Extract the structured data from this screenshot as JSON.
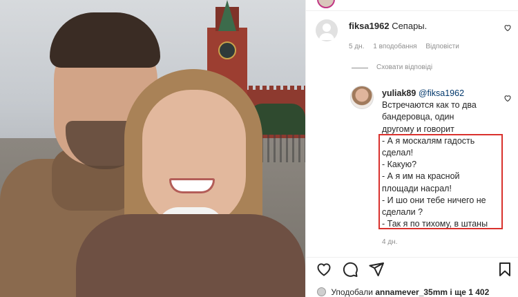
{
  "comments": [
    {
      "username": "fiksa1962",
      "text": "Сепары.",
      "time": "5 дн.",
      "likes": "1 вподобання",
      "reply": "Відповісти"
    },
    {
      "username": "yuliak89",
      "mention": "@fiksa1962",
      "lines": [
        "Встречаются как то два",
        "бандеровца, один",
        "другому и говорит",
        "- А я москалям гадость",
        "сделал!",
        "- Какую?",
        "- А я им на красной",
        "площади насрал!",
        "- И шо они тебе ничего не",
        "сделали ?",
        "- Так я по тихому, в штаны"
      ],
      "time": "4 дн."
    }
  ],
  "hide_replies": "Сховати відповіді",
  "icons": [
    "heart-icon",
    "comment-icon",
    "share-icon",
    "bookmark-icon"
  ],
  "likes_prefix": "Уподобали",
  "likes_user": "annamever_35mm",
  "likes_suffix": "і ще 1 402",
  "highlight_color": "#d9302c"
}
